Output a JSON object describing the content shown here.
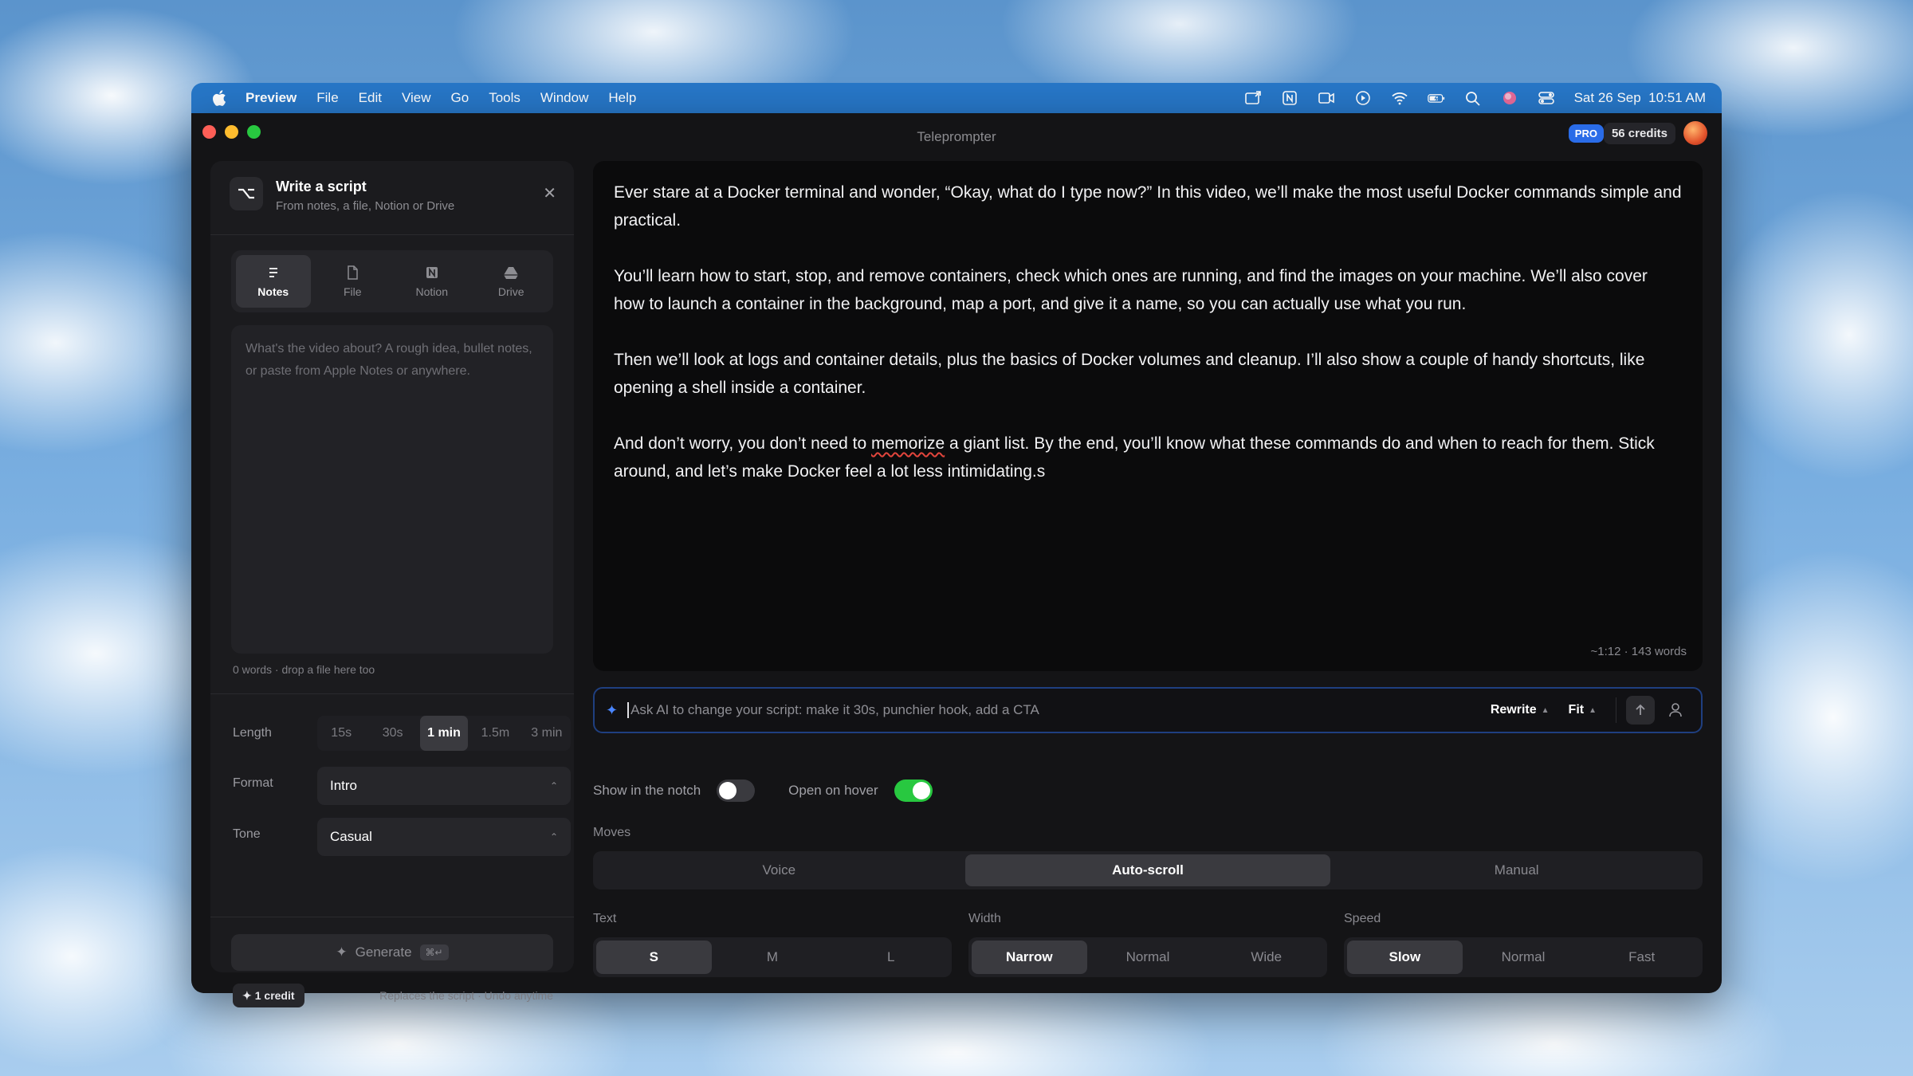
{
  "menubar": {
    "app": "Preview",
    "items": [
      "File",
      "Edit",
      "View",
      "Go",
      "Tools",
      "Window",
      "Help"
    ],
    "datetime": "Sat 26 Sep  10:51 AM"
  },
  "window": {
    "title": "Teleprompter",
    "pro_badge": "PRO",
    "credits": "56 credits"
  },
  "left_panel": {
    "title": "Write a script",
    "subtitle": "From notes, a file, Notion or Drive",
    "source_tabs": [
      {
        "label": "Notes",
        "icon": "notes-icon",
        "active": true
      },
      {
        "label": "File",
        "icon": "file-icon",
        "active": false
      },
      {
        "label": "Notion",
        "icon": "notion-icon",
        "active": false
      },
      {
        "label": "Drive",
        "icon": "drive-icon",
        "active": false
      }
    ],
    "notes_placeholder": "What's the video about? A rough idea, bullet notes, or paste from Apple Notes or anywhere.",
    "notes_meta": "0 words · drop a file here too",
    "length_label": "Length",
    "length_options": [
      "15s",
      "30s",
      "1 min",
      "1.5m",
      "3 min"
    ],
    "length_selected": "1 min",
    "format_label": "Format",
    "format_value": "Intro",
    "tone_label": "Tone",
    "tone_value": "Casual",
    "generate_label": "Generate",
    "generate_shortcut": "⌘↵",
    "credit_cost": "1 credit",
    "replace_note": "Replaces the script · Undo anytime"
  },
  "editor": {
    "paragraphs": [
      "Ever stare at a Docker terminal and wonder, “Okay, what do I type now?” In this video, we’ll make the most useful Docker commands simple and practical.",
      "You’ll learn how to start, stop, and remove containers, check which ones are running, and find the images on your machine. We’ll also cover how to launch a container in the background, map a port, and give it a name, so you can actually use what you run.",
      "Then we’ll look at logs and container details, plus the basics of Docker volumes and cleanup. I’ll also show a couple of handy shortcuts, like opening a shell inside a container.",
      "And don’t worry, you don’t need to memorize a giant list. By the end, you’ll know what these commands do and when to reach for them. Stick around, and let’s make Docker feel a lot less intimidating.s"
    ],
    "p4_before": "And don’t worry, you don’t need to ",
    "p4_misspelled": "memorize",
    "p4_after": " a giant list. By the end, you’ll know what these commands do and when to reach for them. Stick around, and let’s make Docker feel a lot less intimidating.s",
    "word_count": "~1:12 · 143 words"
  },
  "ai_bar": {
    "placeholder": "Ask AI to change your script: make it 30s, punchier hook, add a CTA",
    "rewrite_label": "Rewrite",
    "fit_label": "Fit"
  },
  "controls": {
    "show_notch_label": "Show in the notch",
    "show_notch_on": false,
    "open_hover_label": "Open on hover",
    "open_hover_on": true,
    "moves_label": "Moves",
    "moves_options": [
      "Voice",
      "Auto-scroll",
      "Manual"
    ],
    "moves_selected": "Auto-scroll",
    "text_label": "Text",
    "text_options": [
      "S",
      "M",
      "L"
    ],
    "text_selected": "S",
    "width_label": "Width",
    "width_options": [
      "Narrow",
      "Normal",
      "Wide"
    ],
    "width_selected": "Narrow",
    "speed_label": "Speed",
    "speed_options": [
      "Slow",
      "Normal",
      "Fast"
    ],
    "speed_selected": "Slow"
  },
  "colors": {
    "accent": "#2a6ce8",
    "toggle_on": "#28c840",
    "menubar": "#2777c8"
  }
}
